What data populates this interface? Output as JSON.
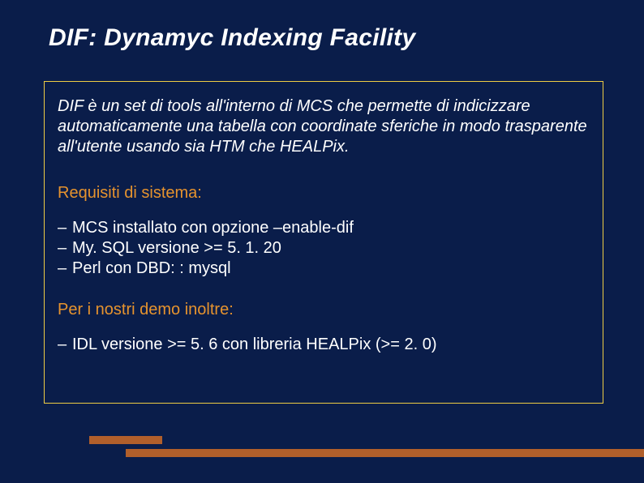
{
  "title": "DIF: Dynamyc Indexing Facility",
  "intro": "DIF è un set di tools all'interno di MCS che permette di indicizzare automaticamente una tabella con coordinate sferiche in modo trasparente all'utente usando sia HTM che HEALPix.",
  "req_label": "Requisiti di sistema:",
  "req_items": [
    "MCS installato con opzione –enable-dif",
    "My. SQL versione >= 5. 1. 20",
    "Perl con DBD: : mysql"
  ],
  "demo_label": "Per i nostri demo inoltre:",
  "demo_items": [
    "IDL versione >= 5. 6 con libreria HEALPix (>= 2. 0)"
  ]
}
